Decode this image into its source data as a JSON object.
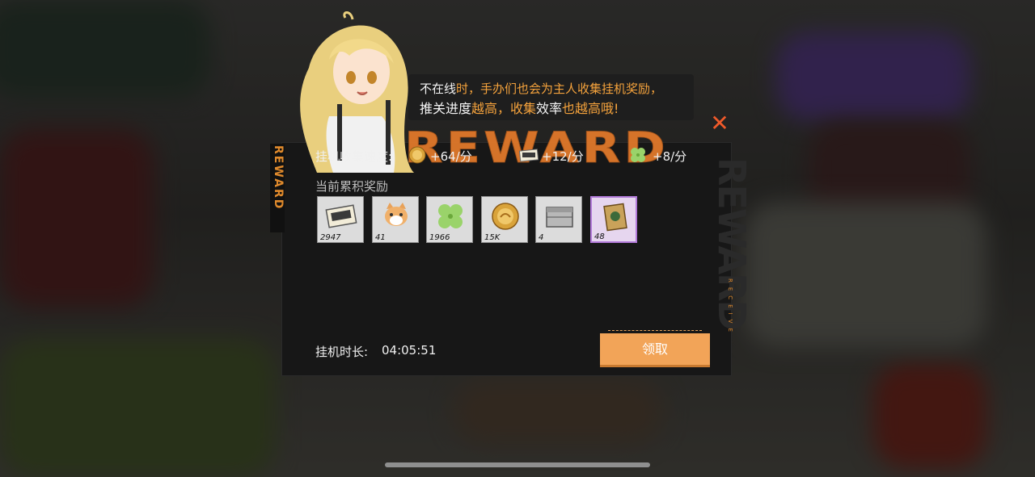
{
  "bubble": {
    "line1": [
      {
        "text": "不在线",
        "hl": false
      },
      {
        "text": "时，手办们也会为主人收集挂机奖励，",
        "hl": true
      }
    ],
    "line2": [
      {
        "text": "推关进度",
        "hl": false
      },
      {
        "text": "越高，收集",
        "hl": true
      },
      {
        "text": "效率",
        "hl": false
      },
      {
        "text": "也越高哦!",
        "hl": true
      }
    ]
  },
  "banner": {
    "title": "REWARD",
    "side": "REWARD",
    "right": "REWARD",
    "receive": "RECEIVE"
  },
  "rates": {
    "label": "挂机收集速度:",
    "items": [
      {
        "icon": "gold-coin-icon",
        "text": "+64/分"
      },
      {
        "icon": "ticket-icon",
        "text": "+12/分"
      },
      {
        "icon": "clover-icon",
        "text": "+8/分"
      }
    ]
  },
  "accumulated": {
    "title": "当前累积奖励",
    "items": [
      {
        "icon": "ticket-icon",
        "count": "2947",
        "rarity": "normal"
      },
      {
        "icon": "cat-icon",
        "count": "41",
        "rarity": "normal"
      },
      {
        "icon": "clover-icon",
        "count": "1966",
        "rarity": "normal"
      },
      {
        "icon": "gold-coin-icon",
        "count": "15K",
        "rarity": "normal"
      },
      {
        "icon": "crate-icon",
        "count": "4",
        "rarity": "normal"
      },
      {
        "icon": "card-pack-icon",
        "count": "48",
        "rarity": "purple"
      }
    ]
  },
  "duration": {
    "label": "挂机时长:",
    "value": "04:05:51"
  },
  "claim_button": "领取",
  "close_icon": "close-icon",
  "colors": {
    "accent": "#f2a458",
    "highlight": "#f4a23c",
    "close": "#f05a2a",
    "purple": "#b27ad9"
  }
}
